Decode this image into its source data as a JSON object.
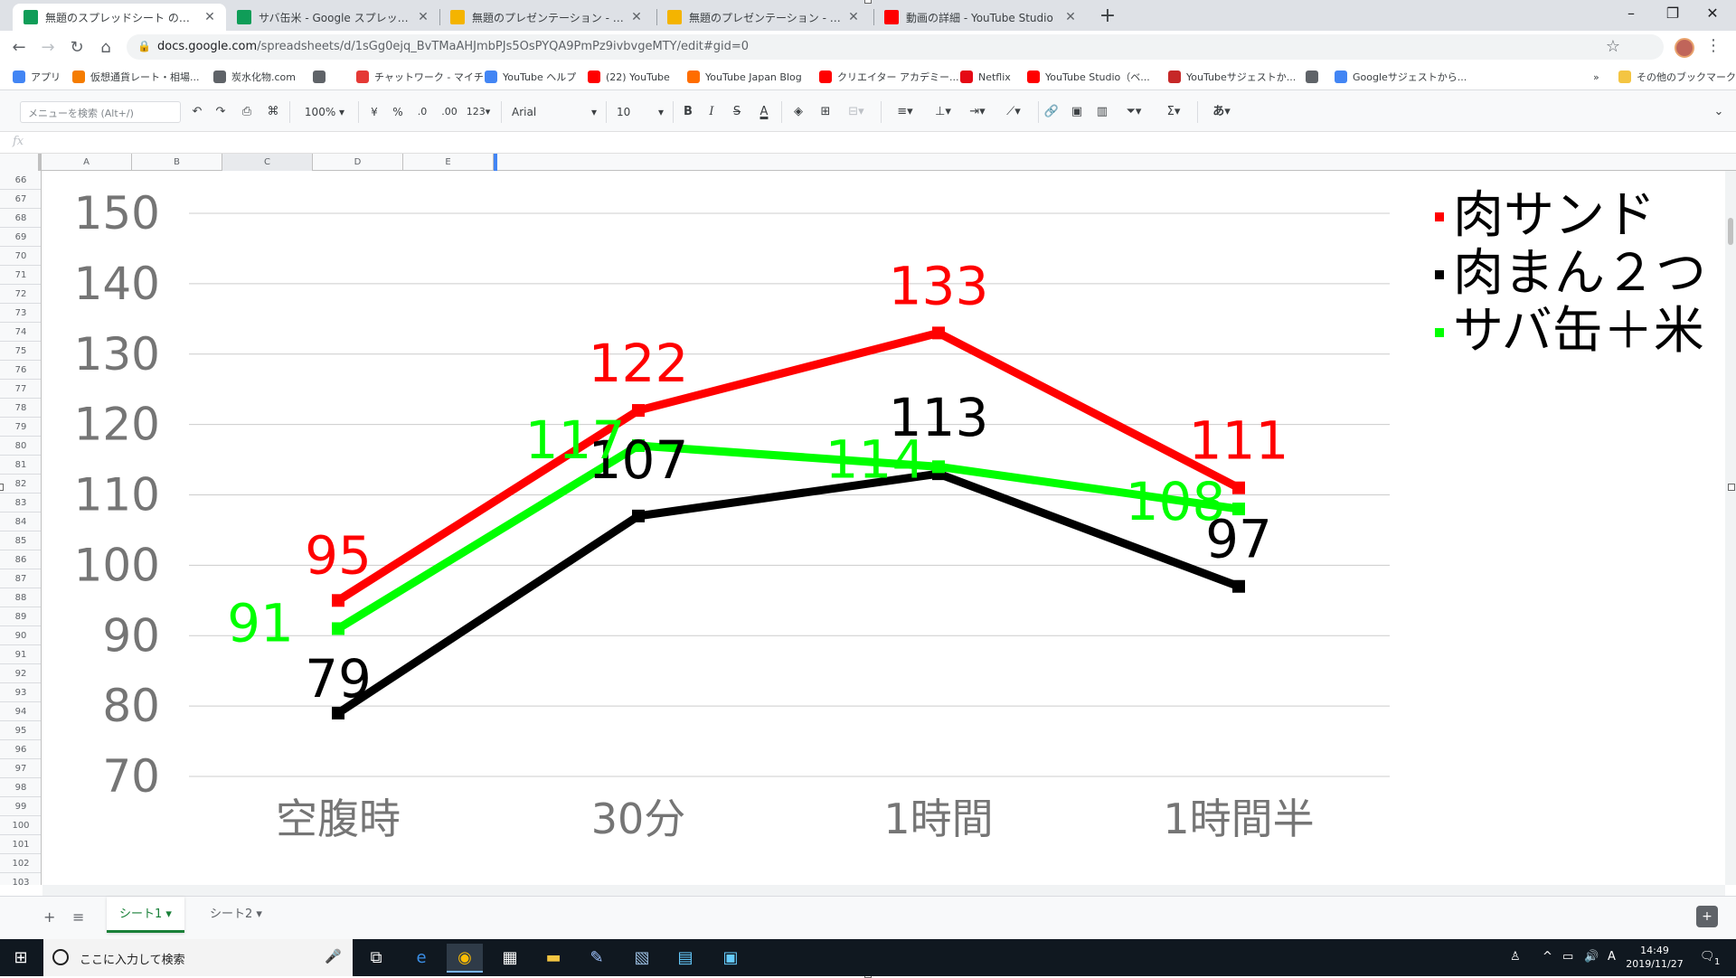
{
  "browser": {
    "tabs": [
      {
        "title": "無題のスプレッドシート のコピー のコピー",
        "icon": "sheets-icon",
        "active": true
      },
      {
        "title": "サバ缶米 - Google スプレッドシート",
        "icon": "sheets-icon",
        "active": false
      },
      {
        "title": "無題のプレゼンテーション - Google スライド",
        "icon": "slides-icon",
        "active": false
      },
      {
        "title": "無題のプレゼンテーション - Google スライド",
        "icon": "slides-icon",
        "active": false
      },
      {
        "title": "動画の詳細 - YouTube Studio",
        "icon": "youtube-icon",
        "active": false
      }
    ],
    "new_tab": "+",
    "url_host": "docs.google.com",
    "url_path": "/spreadsheets/d/1sGg0ejq_BvTMaAHJmbPJs5OsPYQA9PmPz9ivbvgeMTY/edit#gid=0",
    "bookmarks": [
      {
        "label": "アプリ",
        "icon": "apps-grid-icon"
      },
      {
        "label": "仮想通貨レート・相場...",
        "icon": "coin-icon"
      },
      {
        "label": "炭水化物.com",
        "icon": "globe-icon"
      },
      {
        "label": "",
        "icon": "globe-icon"
      },
      {
        "label": "チャットワーク - マイチ...",
        "icon": "chatwork-icon"
      },
      {
        "label": "YouTube ヘルプ",
        "icon": "google-icon"
      },
      {
        "label": "(22) YouTube",
        "icon": "youtube-icon"
      },
      {
        "label": "YouTube Japan Blog",
        "icon": "blogger-icon"
      },
      {
        "label": "クリエイター アカデミー...",
        "icon": "youtube-icon"
      },
      {
        "label": "Netflix",
        "icon": "netflix-icon"
      },
      {
        "label": "YouTube Studio（ベ...",
        "icon": "youtube-icon"
      },
      {
        "label": "YouTubeサジェストか...",
        "icon": "youtube-suggest-icon"
      },
      {
        "label": "",
        "icon": "globe-icon"
      },
      {
        "label": "Googleサジェストから...",
        "icon": "google-icon"
      }
    ],
    "bookmarks_more": "»",
    "other_bookmarks": "その他のブックマーク"
  },
  "toolbar": {
    "menu_search_placeholder": "メニューを検索 (Alt+/)",
    "zoom": "100%",
    "currency": "¥",
    "percent": "%",
    "decimal_less": ".0",
    "decimal_more": ".00",
    "format_more": "123",
    "font": "Arial",
    "font_size": "10",
    "bold": "B",
    "italic": "I",
    "strike": "S",
    "text_color": "A",
    "input_tools": "あ"
  },
  "formula_bar": {
    "fx": "fx"
  },
  "grid": {
    "columns": [
      "A",
      "B",
      "C",
      "D",
      "E"
    ],
    "rows": [
      "66",
      "67",
      "68",
      "69",
      "70",
      "71",
      "72",
      "73",
      "74",
      "75",
      "76",
      "77",
      "78",
      "79",
      "80",
      "81",
      "82",
      "83",
      "84",
      "85",
      "86",
      "87",
      "88",
      "89",
      "90",
      "91",
      "92",
      "93",
      "94",
      "95",
      "96",
      "97",
      "98",
      "99",
      "100",
      "101",
      "102",
      "103"
    ]
  },
  "chart_data": {
    "type": "line",
    "categories": [
      "空腹時",
      "30分",
      "1時間",
      "1時間半"
    ],
    "ylim": [
      70,
      150
    ],
    "yticks": [
      "150",
      "140",
      "130",
      "120",
      "110",
      "100",
      "90",
      "80",
      "70"
    ],
    "grid": true,
    "legend_position": "top-right",
    "series": [
      {
        "name": "肉サンド",
        "color": "#ff0000",
        "values": [
          95,
          122,
          133,
          111
        ]
      },
      {
        "name": "肉まん２つ",
        "color": "#000000",
        "values": [
          79,
          107,
          113,
          97
        ]
      },
      {
        "name": "サバ缶＋米",
        "color": "#00ff00",
        "values": [
          91,
          117,
          114,
          108
        ]
      }
    ]
  },
  "sheet_tabs": {
    "add": "+",
    "all_sheets": "≡",
    "tabs": [
      {
        "label": "シート1",
        "active": true
      },
      {
        "label": "シート2",
        "active": false
      }
    ]
  },
  "taskbar": {
    "search_placeholder": "ここに入力して検索",
    "ime": "A",
    "time": "14:49",
    "date": "2019/11/27",
    "notification_count": "1"
  }
}
